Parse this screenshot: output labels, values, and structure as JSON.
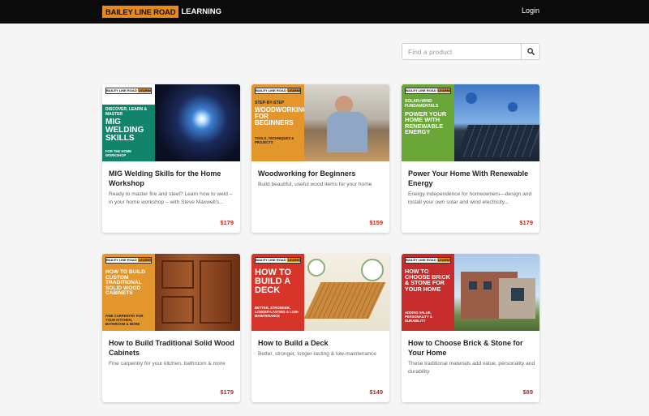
{
  "header": {
    "logo_part1": "BAILEY LINE ROAD",
    "logo_part2": "LEARNING",
    "login_label": "Login"
  },
  "search": {
    "placeholder": "Find a product",
    "icon": "search-icon"
  },
  "colors": {
    "header_bg": "#0b0b0b",
    "brand_orange": "#e8891c",
    "price_red": "#b32e1f"
  },
  "products": [
    {
      "title": "MIG Welding Skills for the Home Workshop",
      "description": "Ready to master fire and steel? Learn how to weld – in your home workshop – with Steve Maxwell's...",
      "price": "$179",
      "thumb": {
        "kicker": "Discover, Learn & Master",
        "big": "MIG Welding Skills",
        "small": "for the Home Workshop"
      }
    },
    {
      "title": "Woodworking for Beginners",
      "description": "Build beautiful, useful wood items for your home",
      "price": "$159",
      "thumb": {
        "kicker": "Step-by-Step",
        "big": "Woodworking for Beginners",
        "small": "Tools, Techniques & Projects"
      }
    },
    {
      "title": "Power Your Home With Renewable Energy",
      "description": "Energy independence for homeowners—design and install your own solar and wind electricity...",
      "price": "$179",
      "thumb": {
        "kicker": "Solar+Wind Fundamentals",
        "big": "Power Your Home With Renewable Energy",
        "small": ""
      }
    },
    {
      "title": "How to Build Traditional Solid Wood Cabinets",
      "description": "Fine carpentry for your kitchen, bathroom & more",
      "price": "$179",
      "thumb": {
        "kicker": "",
        "big": "How to Build Custom Traditional Solid Wood Cabinets",
        "small": "Fine Carpentry for your Kitchen, Bathroom & More"
      }
    },
    {
      "title": "How to Build a Deck",
      "description": "Better, stronger, longer-lasting & low-maintenance",
      "price": "$149",
      "thumb": {
        "kicker": "",
        "big": "How to Build a Deck",
        "small": "Better, Stronger, Longer-Lasting & Low-Maintenance"
      }
    },
    {
      "title": "How to Choose Brick & Stone for Your Home",
      "description": "These traditional materials add value, personality and durability",
      "price": "$89",
      "thumb": {
        "kicker": "",
        "big": "How to Choose Brick & Stone for Your Home",
        "small": "Adding Value, Personality & Durability"
      }
    }
  ]
}
